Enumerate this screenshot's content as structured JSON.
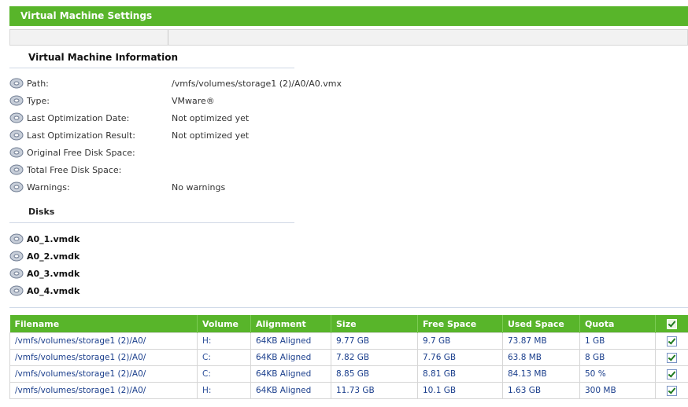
{
  "window": {
    "title": "Virtual Machine Settings"
  },
  "info": {
    "title": "Virtual Machine Information",
    "rows": [
      {
        "label": "Path:",
        "value": "/vmfs/volumes/storage1 (2)/A0/A0.vmx"
      },
      {
        "label": "Type:",
        "value": "VMware®"
      },
      {
        "label": "Last Optimization Date:",
        "value": "Not optimized yet"
      },
      {
        "label": "Last Optimization Result:",
        "value": "Not optimized yet"
      },
      {
        "label": "Original Free Disk Space:",
        "value": ""
      },
      {
        "label": "Total Free Disk Space:",
        "value": ""
      },
      {
        "label": "Warnings:",
        "value": "No warnings"
      }
    ]
  },
  "disks": {
    "title": "Disks",
    "items": [
      "A0_1.vmdk",
      "A0_2.vmdk",
      "A0_3.vmdk",
      "A0_4.vmdk"
    ]
  },
  "table": {
    "headers": [
      "Filename",
      "Volume",
      "Alignment",
      "Size",
      "Free Space",
      "Used Space",
      "Quota"
    ],
    "rows": [
      [
        "/vmfs/volumes/storage1 (2)/A0/",
        "H:",
        "64KB Aligned",
        "9.77 GB",
        "9.7 GB",
        "73.87 MB",
        "1 GB"
      ],
      [
        "/vmfs/volumes/storage1 (2)/A0/",
        "C:",
        "64KB Aligned",
        "7.82 GB",
        "7.76 GB",
        "63.8 MB",
        "8 GB"
      ],
      [
        "/vmfs/volumes/storage1 (2)/A0/",
        "C:",
        "64KB Aligned",
        "8.85 GB",
        "8.81 GB",
        "84.13 MB",
        "50 %"
      ],
      [
        "/vmfs/volumes/storage1 (2)/A0/",
        "H:",
        "64KB Aligned",
        "11.73 GB",
        "10.1 GB",
        "1.63 GB",
        "300 MB"
      ]
    ],
    "checked": [
      true,
      true,
      true,
      true
    ],
    "header_checked": true
  }
}
